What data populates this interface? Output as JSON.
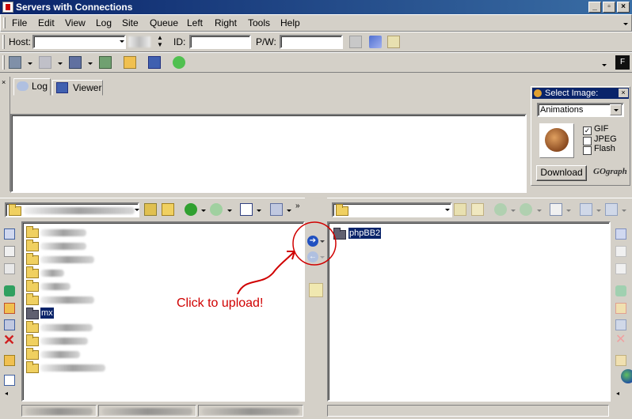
{
  "window": {
    "title": "Servers with Connections"
  },
  "menu": {
    "items": [
      "File",
      "Edit",
      "View",
      "Log",
      "Site",
      "Queue",
      "Left",
      "Right",
      "Tools",
      "Help"
    ]
  },
  "connect_bar": {
    "host_label": "Host:",
    "host_value": "",
    "id_label": "ID:",
    "pw_label": "P/W:"
  },
  "tabs": {
    "log": "Log",
    "viewer": "Viewer"
  },
  "image_panel": {
    "title": "Select Image:",
    "dropdown_value": "Animations",
    "gif": "GIF",
    "jpeg": "JPEG",
    "flash": "Flash",
    "gif_checked": true,
    "download": "Download",
    "logo": "GOgraph"
  },
  "remote_pane": {
    "items": [
      {
        "name": "phpBB2",
        "selected": true
      }
    ]
  },
  "local_pane": {
    "selected_folder": "mx"
  },
  "annotation": {
    "text": "Click to upload!",
    "color": "#d00000"
  }
}
